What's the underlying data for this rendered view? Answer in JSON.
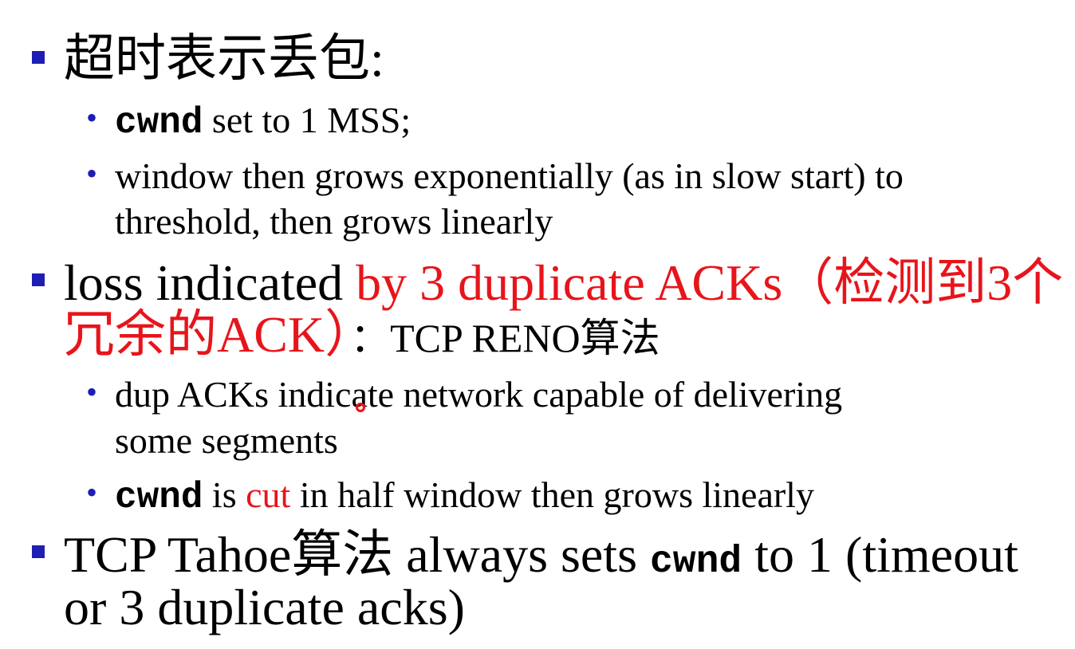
{
  "slide": {
    "b1": {
      "text": "超时表示丢包:"
    },
    "b1_s1": {
      "code": "cwnd",
      "text": " set to 1 MSS;"
    },
    "b1_s2": {
      "line1": "window then grows exponentially (as in slow start) to",
      "line2": "threshold, then grows linearly"
    },
    "b2": {
      "pre": "loss indicated ",
      "red1": "by 3 duplicate ACKs（检测到3个",
      "red2": "冗余的ACK）",
      "post": "：TCP RENO算法"
    },
    "b2_s1": {
      "line1": "dup ACKs indicate network capable of  delivering",
      "line2": "some segments"
    },
    "b2_s2": {
      "code": "cwnd",
      "mid1": " is ",
      "red": "cut",
      "mid2": " in half window then grows linearly"
    },
    "b3": {
      "pre": "TCP Tahoe算法 always sets ",
      "code": "cwnd",
      "post": " to 1 (timeout",
      "line2": "or 3 duplicate acks)"
    }
  },
  "colors": {
    "bullet": "#1e1eb4",
    "highlight": "#e8141b",
    "text": "#000000"
  },
  "icons": {
    "level1_bullet": "blue-square",
    "level2_bullet": "blue-dot",
    "cursor": "red-circle-pointer"
  }
}
